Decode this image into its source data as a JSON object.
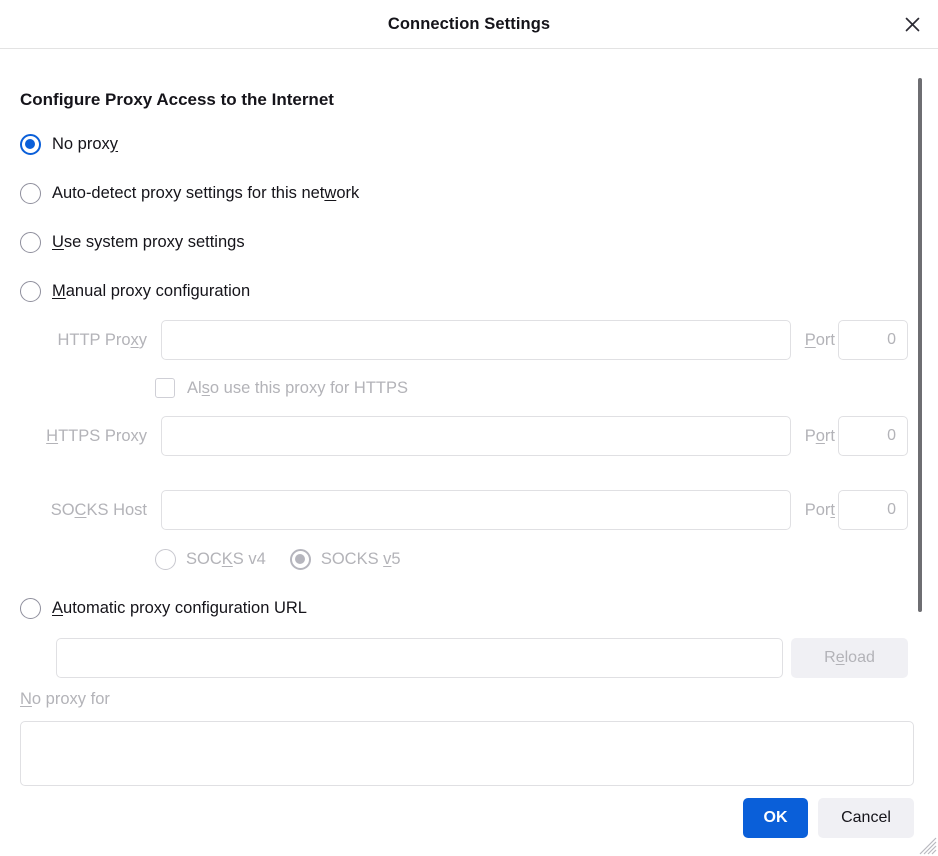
{
  "window": {
    "title": "Connection Settings",
    "close_icon": "close-icon"
  },
  "section": {
    "heading": "Configure Proxy Access to the Internet"
  },
  "proxy_mode": {
    "selected": "no_proxy",
    "options": [
      {
        "id": "no_proxy",
        "label": "No proxy",
        "accesskey": "y",
        "checked": true,
        "disabled": false
      },
      {
        "id": "auto_detect",
        "label": "Auto-detect proxy settings for this network",
        "accesskey": "w",
        "checked": false,
        "disabled": false
      },
      {
        "id": "system",
        "label": "Use system proxy settings",
        "accesskey": "U",
        "checked": false,
        "disabled": false
      },
      {
        "id": "manual",
        "label": "Manual proxy configuration",
        "accesskey": "M",
        "checked": false,
        "disabled": false
      },
      {
        "id": "auto_url",
        "label": "Automatic proxy configuration URL",
        "accesskey": "A",
        "checked": false,
        "disabled": false
      }
    ]
  },
  "manual": {
    "http": {
      "label": "HTTP Proxy",
      "value": "",
      "port_label": "Port",
      "port_value": "0"
    },
    "share_https": {
      "label": "Also use this proxy for HTTPS",
      "checked": false,
      "disabled": true
    },
    "https": {
      "label": "HTTPS Proxy",
      "value": "",
      "port_label": "Port",
      "port_value": "0"
    },
    "socks": {
      "label": "SOCKS Host",
      "value": "",
      "port_label": "Port",
      "port_value": "0"
    },
    "socks_version": {
      "selected": "v5",
      "options": [
        {
          "id": "v4",
          "label": "SOCKS v4",
          "checked": false
        },
        {
          "id": "v5",
          "label": "SOCKS v5",
          "checked": true
        }
      ]
    }
  },
  "pac": {
    "url_value": "",
    "reload_label": "Reload",
    "reload_disabled": true
  },
  "no_proxy_for": {
    "label": "No proxy for",
    "value": ""
  },
  "footer": {
    "ok_label": "OK",
    "cancel_label": "Cancel",
    "grip_icon": "resize-grip-icon"
  },
  "colors": {
    "accent": "#0a5fd9",
    "text": "#15141a",
    "disabled_text": "#b3b3b8",
    "button_secondary": "#f0f0f4",
    "border": "#e0e0e3",
    "scrollbar": "#6e6e72"
  }
}
